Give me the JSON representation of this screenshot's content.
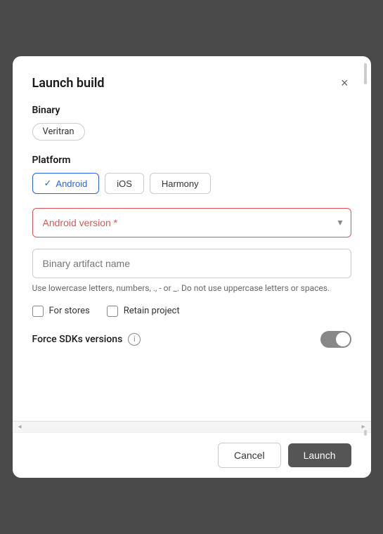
{
  "dialog": {
    "title": "Launch build",
    "close_label": "×"
  },
  "binary": {
    "label": "Binary",
    "chip_text": "Veritran"
  },
  "platform": {
    "label": "Platform",
    "buttons": [
      {
        "id": "android",
        "label": "Android",
        "active": true
      },
      {
        "id": "ios",
        "label": "iOS",
        "active": false
      },
      {
        "id": "harmony",
        "label": "Harmony",
        "active": false
      }
    ]
  },
  "android_version": {
    "placeholder": "Android version *"
  },
  "artifact": {
    "placeholder": "Binary artifact name",
    "hint": "Use lowercase letters, numbers, ., - or _. Do not use uppercase letters or spaces."
  },
  "checkboxes": [
    {
      "id": "for-stores",
      "label": "For stores",
      "checked": false
    },
    {
      "id": "retain-project",
      "label": "Retain project",
      "checked": false
    }
  ],
  "force_sdk": {
    "label": "Force SDKs versions",
    "info_symbol": "i",
    "enabled": false
  },
  "footer": {
    "cancel_label": "Cancel",
    "launch_label": "Launch"
  }
}
